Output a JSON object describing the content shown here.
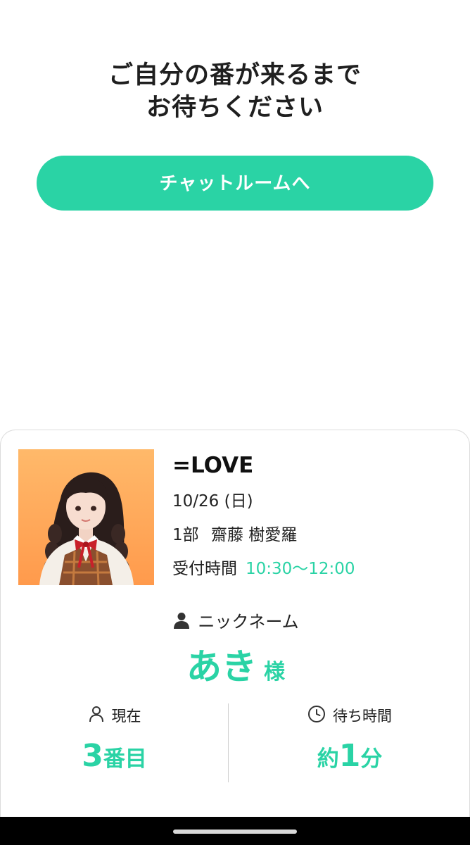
{
  "heading": {
    "line1": "ご自分の番が来るまで",
    "line2": "お待ちください"
  },
  "chat_button_label": "チャットルームへ",
  "ticket": {
    "group": "=LOVE",
    "date": "10/26 (日)",
    "session": "1部",
    "member": "齋藤 樹愛羅",
    "reception_label": "受付時間",
    "reception_time": "10:30〜12:00"
  },
  "nickname": {
    "label": "ニックネーム",
    "value": "あき",
    "honorific": "様"
  },
  "current": {
    "label": "現在",
    "number": "3",
    "suffix": "番目"
  },
  "wait": {
    "label": "待ち時間",
    "prefix": "約",
    "number": "1",
    "suffix": "分"
  },
  "colors": {
    "accent": "#2ad3a5",
    "photo_background": "#ffa857"
  },
  "icons": {
    "nickname": "person-filled-icon",
    "current": "person-outline-icon",
    "wait": "clock-icon"
  }
}
